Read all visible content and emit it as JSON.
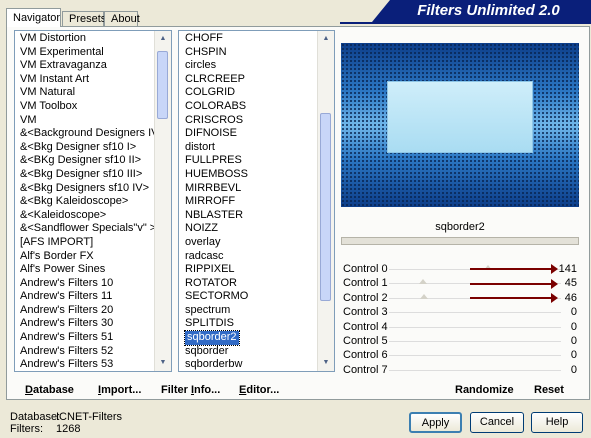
{
  "tabs": [
    "Navigator",
    "Presets",
    "About"
  ],
  "app_title": "Filters Unlimited 2.0",
  "categories": [
    "VM Distortion",
    "VM Experimental",
    "VM Extravaganza",
    "VM Instant Art",
    "VM Natural",
    "VM Toolbox",
    "VM",
    "&<Background Designers IV>",
    "&<Bkg Designer sf10 I>",
    "&<BKg Designer sf10 II>",
    "&<Bkg Designer sf10 III>",
    "&<Bkg Designers sf10 IV>",
    "&<Bkg Kaleidoscope>",
    "&<Kaleidoscope>",
    "&<Sandflower Specials\"v\" >",
    "[AFS IMPORT]",
    "Alf's Border FX",
    "Alf's Power Sines",
    "Andrew's Filters 10",
    "Andrew's Filters 11",
    "Andrew's Filters 20",
    "Andrew's Filters 30",
    "Andrew's Filters 51",
    "Andrew's Filters 52",
    "Andrew's Filters 53"
  ],
  "filters": [
    "CHOFF",
    "CHSPIN",
    "circles",
    "CLRCREEP",
    "COLGRID",
    "COLORABS",
    "CRISCROS",
    "DIFNOISE",
    "distort",
    "FULLPRES",
    "HUEMBOSS",
    "MIRRBEVL",
    "MIRROFF",
    "NBLASTER",
    "NOIZZ",
    "overlay",
    "radcasc",
    "RIPPIXEL",
    "ROTATOR",
    "SECTORMO",
    "spectrum",
    "SPLITDIS",
    "sqborder2",
    "sqborder",
    "sqborderbw"
  ],
  "selected_filter": "sqborder2",
  "selected_filter_index": 22,
  "filter_name_display": "sqborder2",
  "controls": [
    {
      "label": "Control 0",
      "value": "141",
      "level": 0.553
    },
    {
      "label": "Control 1",
      "value": "45",
      "level": 0.176
    },
    {
      "label": "Control 2",
      "value": "46",
      "level": 0.18
    },
    {
      "label": "Control 3",
      "value": "0",
      "level": 0
    },
    {
      "label": "Control 4",
      "value": "0",
      "level": 0
    },
    {
      "label": "Control 5",
      "value": "0",
      "level": 0
    },
    {
      "label": "Control 6",
      "value": "0",
      "level": 0
    },
    {
      "label": "Control 7",
      "value": "0",
      "level": 0
    }
  ],
  "links": {
    "database_u": "D",
    "database_rest": "atabase",
    "import_u": "I",
    "import_rest": "mport...",
    "filterinfo_pre": "Filter ",
    "filterinfo_u": "I",
    "filterinfo_rest": "nfo...",
    "editor_u": "E",
    "editor_rest": "ditor...",
    "randomize": "Randomize",
    "reset": "Reset"
  },
  "status": {
    "database_label": "Database:",
    "database_value": "ICNET-Filters",
    "filters_label": "Filters:",
    "filters_value": "1268"
  },
  "buttons": {
    "apply": "Apply",
    "cancel": "Cancel",
    "help": "Help"
  },
  "colors": {
    "banner": "#0a1f7a",
    "selection": "#316ac5",
    "arrow": "#7a0000"
  }
}
